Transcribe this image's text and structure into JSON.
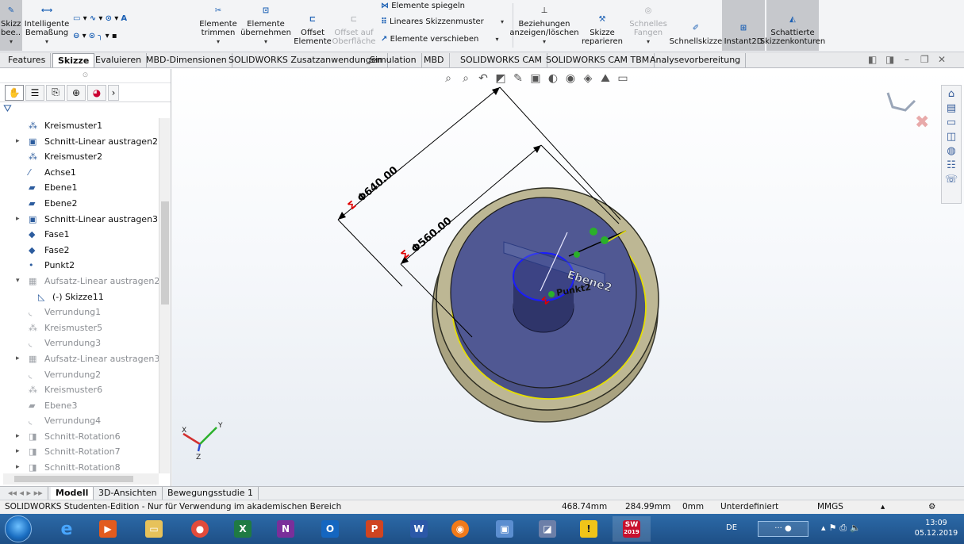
{
  "ribbon": {
    "sketch_btn": "Skizze bee...",
    "smart_dim": "Intelligente Bemaßung",
    "trim": "Elemente trimmen",
    "convert": "Elemente übernehmen",
    "offset": "Offset Elemente",
    "offset_surface": "Offset auf Oberfläche",
    "mirror": "Elemente spiegeln",
    "linear_pattern": "Lineares Skizzenmuster",
    "move": "Elemente verschieben",
    "relations": "Beziehungen anzeigen/löschen",
    "repair": "Skizze reparieren",
    "quick_snaps": "Schnelles Fangen",
    "rapid_sketch": "Schnellskizze",
    "instant2d": "Instant2D",
    "shaded": "Schattierte Skizzenkonturen"
  },
  "tabs": [
    "Features",
    "Skizze",
    "Evaluieren",
    "MBD-Dimensionen",
    "SOLIDWORKS Zusatzanwendungen",
    "Simulation",
    "MBD",
    "SOLIDWORKS CAM",
    "SOLIDWORKS CAM TBM",
    "Analysevorbereitung"
  ],
  "tree": [
    {
      "label": "Kreismuster1",
      "icon": "circular-pattern-icon"
    },
    {
      "label": "Schnitt-Linear austragen2",
      "icon": "cut-extrude-icon"
    },
    {
      "label": "Kreismuster2",
      "icon": "circular-pattern-icon"
    },
    {
      "label": "Achse1",
      "icon": "axis-icon"
    },
    {
      "label": "Ebene1",
      "icon": "plane-icon"
    },
    {
      "label": "Ebene2",
      "icon": "plane-icon"
    },
    {
      "label": "Schnitt-Linear austragen3",
      "icon": "cut-extrude-icon"
    },
    {
      "label": "Fase1",
      "icon": "chamfer-icon"
    },
    {
      "label": "Fase2",
      "icon": "chamfer-icon"
    },
    {
      "label": "Punkt2",
      "icon": "point-icon"
    },
    {
      "label": "Aufsatz-Linear austragen2",
      "icon": "boss-extrude-icon"
    },
    {
      "label": "(-) Skizze11",
      "icon": "sketch-icon"
    },
    {
      "label": "Verrundung1",
      "icon": "fillet-icon"
    },
    {
      "label": "Kreismuster5",
      "icon": "circular-pattern-icon"
    },
    {
      "label": "Verrundung3",
      "icon": "fillet-icon"
    },
    {
      "label": "Aufsatz-Linear austragen3",
      "icon": "boss-extrude-icon"
    },
    {
      "label": "Verrundung2",
      "icon": "fillet-icon"
    },
    {
      "label": "Kreismuster6",
      "icon": "circular-pattern-icon"
    },
    {
      "label": "Ebene3",
      "icon": "plane-icon"
    },
    {
      "label": "Verrundung4",
      "icon": "fillet-icon"
    },
    {
      "label": "Schnitt-Rotation6",
      "icon": "cut-revolve-icon"
    },
    {
      "label": "Schnitt-Rotation7",
      "icon": "cut-revolve-icon"
    },
    {
      "label": "Schnitt-Rotation8",
      "icon": "cut-revolve-icon"
    }
  ],
  "viewport": {
    "dim_outer": "Φ640.00",
    "dim_inner": "Φ560.00",
    "plane_label": "Ebene2",
    "point_label": "Punkt2",
    "colors": {
      "rim": "#b9b38f",
      "bore": "#474e86",
      "hub": "#2d3366",
      "edge": "#e8e000",
      "dim": "#000000",
      "dim_marker": "#e00000"
    }
  },
  "model_tabs": [
    "Modell",
    "3D-Ansichten",
    "Bewegungsstudie 1"
  ],
  "status": {
    "text": "SOLIDWORKS Studenten-Edition - Nur für Verwendung im akademischen Bereich",
    "x": "468.74mm",
    "y": "284.99mm",
    "z": "0mm",
    "state": "Unterdefiniert",
    "units": "MMGS"
  },
  "taskbar": {
    "lang": "DE",
    "time": "13:09",
    "date": "05.12.2019",
    "sw_badge": "2019"
  }
}
